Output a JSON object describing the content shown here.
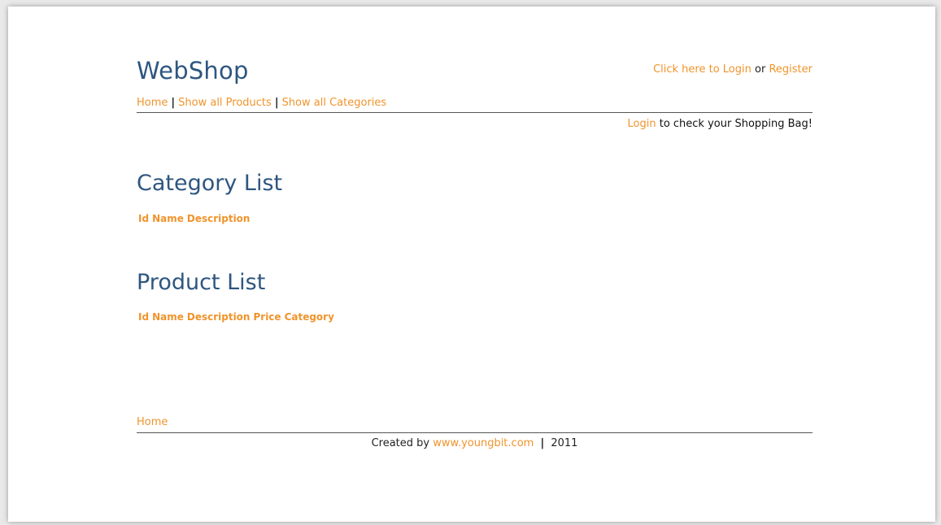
{
  "header": {
    "logo": "WebShop",
    "login_link": "Click here to Login",
    "login_or": "or",
    "register_link": "Register"
  },
  "nav": {
    "items": [
      {
        "label": "Home"
      },
      {
        "label": "Show all Products"
      },
      {
        "label": "Show all Categories"
      }
    ],
    "separator": "|"
  },
  "bag": {
    "login_link": "Login",
    "text": "to check your Shopping Bag!"
  },
  "category_list": {
    "title": "Category List",
    "columns": [
      "Id",
      "Name",
      "Description"
    ]
  },
  "product_list": {
    "title": "Product List",
    "columns": [
      "Id",
      "Name",
      "Description",
      "Price",
      "Category"
    ]
  },
  "footer": {
    "home_link": "Home",
    "created_by": "Created by",
    "site_link": "www.youngbit.com",
    "separator": "|",
    "year": "2011"
  },
  "colors": {
    "accent": "#f0942c",
    "heading": "#2e5680"
  }
}
